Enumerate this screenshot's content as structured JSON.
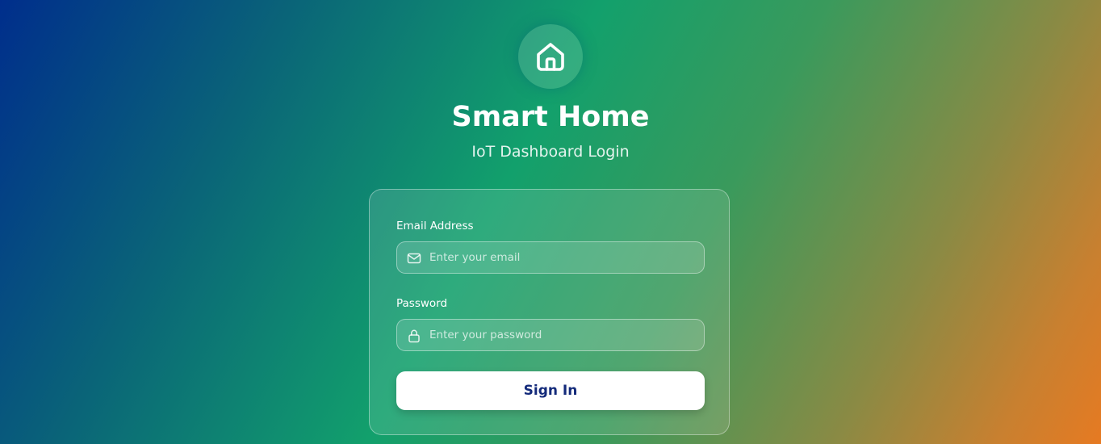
{
  "header": {
    "logo_icon": "house-icon",
    "title": "Smart Home",
    "subtitle": "IoT Dashboard Login"
  },
  "form": {
    "email": {
      "label": "Email Address",
      "icon": "mail-icon",
      "placeholder": "Enter your email",
      "value": ""
    },
    "password": {
      "label": "Password",
      "icon": "lock-icon",
      "placeholder": "Enter your password",
      "value": ""
    },
    "submit_label": "Sign In"
  },
  "colors": {
    "gradient_start": "#002e8c",
    "gradient_mid": "#12a06c",
    "gradient_end": "#e67a22",
    "button_text": "#132a7a",
    "button_background": "#ffffff"
  }
}
